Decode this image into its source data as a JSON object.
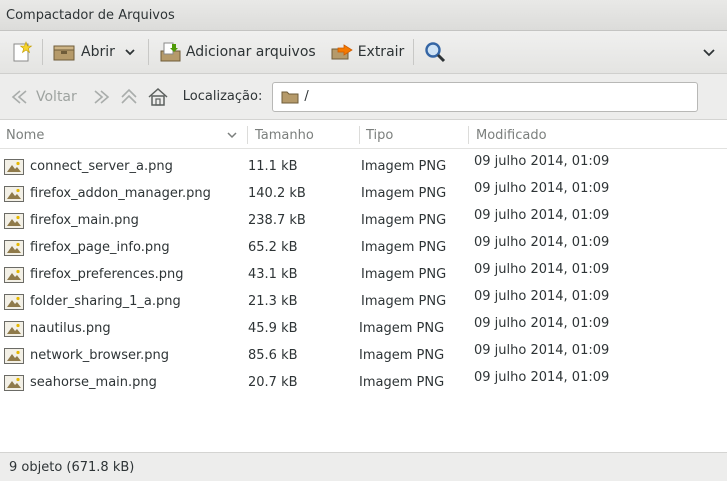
{
  "window": {
    "title": "Compactador de Arquivos"
  },
  "toolbar": {
    "open_label": "Abrir",
    "add_label": "Adicionar arquivos",
    "extract_label": "Extrair"
  },
  "nav": {
    "back_label": "Voltar",
    "location_label": "Localização:",
    "location_value": "/"
  },
  "columns": {
    "name": "Nome",
    "size": "Tamanho",
    "type": "Tipo",
    "modified": "Modificado"
  },
  "files": [
    {
      "name": "connect_server_a.png",
      "size": "11.1 kB",
      "type": "Imagem PNG",
      "modified": "09 julho 2014, 01:09"
    },
    {
      "name": "firefox_addon_manager.png",
      "size": "140.2 kB",
      "type": "Imagem PNG",
      "modified": "09 julho 2014, 01:09"
    },
    {
      "name": "firefox_main.png",
      "size": "238.7 kB",
      "type": "Imagem PNG",
      "modified": "09 julho 2014, 01:09"
    },
    {
      "name": "firefox_page_info.png",
      "size": "65.2 kB",
      "type": "Imagem PNG",
      "modified": "09 julho 2014, 01:09"
    },
    {
      "name": "firefox_preferences.png",
      "size": "43.1 kB",
      "type": "Imagem PNG",
      "modified": "09 julho 2014, 01:09"
    },
    {
      "name": "folder_sharing_1_a.png",
      "size": "21.3 kB",
      "type": "Imagem PNG",
      "modified": "09 julho 2014, 01:09"
    },
    {
      "name": "nautilus.png",
      "size": "45.9 kB",
      "type": "Imagem PNG",
      "modified": "09 julho 2014, 01:09"
    },
    {
      "name": "network_browser.png",
      "size": "85.6 kB",
      "type": "Imagem PNG",
      "modified": "09 julho 2014, 01:09"
    },
    {
      "name": "seahorse_main.png",
      "size": "20.7 kB",
      "type": "Imagem PNG",
      "modified": "09 julho 2014, 01:09"
    }
  ],
  "status": {
    "text": "9 objeto (671.8 kB)"
  },
  "icons": {
    "new": "new-archive-icon",
    "open": "open-archive-icon",
    "add": "add-files-icon",
    "extract": "extract-icon",
    "find": "search-icon",
    "file": "image-file-icon"
  }
}
